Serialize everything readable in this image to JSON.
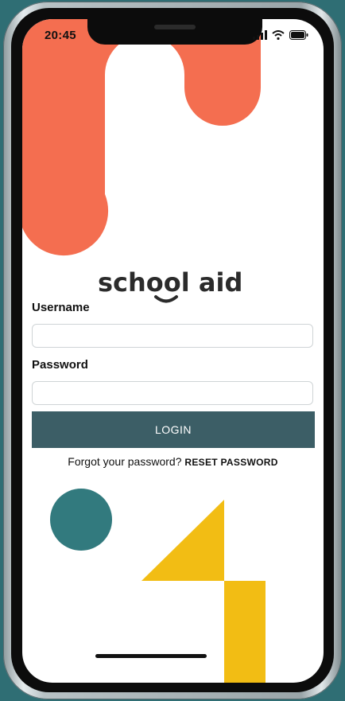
{
  "status_bar": {
    "time": "20:45"
  },
  "brand": {
    "name": "school aid"
  },
  "form": {
    "username_label": "Username",
    "username_value": "",
    "password_label": "Password",
    "password_value": "",
    "login_label": "LOGIN",
    "forgot_text": "Forgot your password?",
    "reset_label": "RESET PASSWORD"
  },
  "colors": {
    "coral": "#f46e50",
    "teal": "#327a7e",
    "yellow": "#f2bd14",
    "button": "#3c5e66",
    "background": "#2f6e74"
  },
  "icons": [
    "signal-icon",
    "wifi-icon",
    "battery-icon"
  ]
}
